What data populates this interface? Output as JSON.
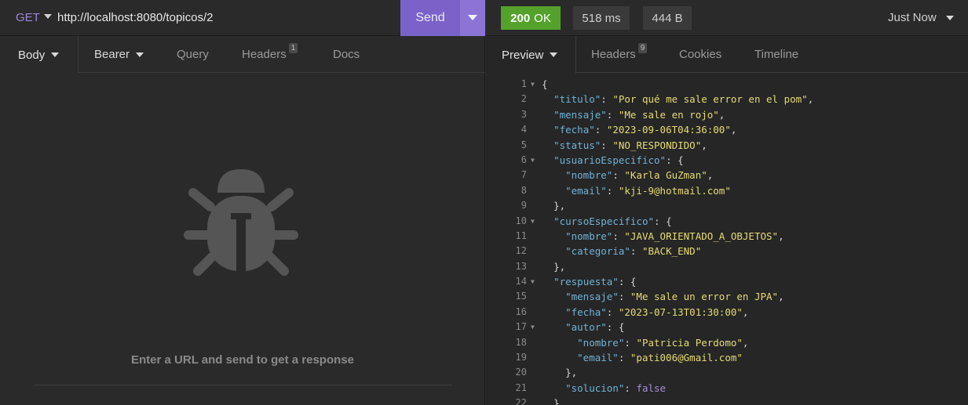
{
  "request": {
    "method": "GET",
    "url": "http://localhost:8080/topicos/2",
    "send_label": "Send",
    "tabs": {
      "body": "Body",
      "auth": "Bearer",
      "query": "Query",
      "headers": "Headers",
      "headers_count": "1",
      "docs": "Docs"
    },
    "empty_message": "Enter a URL and send to get a response",
    "empty_icon": "bug-icon"
  },
  "response": {
    "status_code": "200",
    "status_text": "OK",
    "time": "518 ms",
    "size": "444 B",
    "when": "Just Now",
    "colors": {
      "status_ok": "#54a22b",
      "accent": "#7b62c9"
    },
    "tabs": {
      "preview": "Preview",
      "headers": "Headers",
      "headers_count": "9",
      "cookies": "Cookies",
      "timeline": "Timeline"
    },
    "lines": [
      {
        "n": "1",
        "fold": true,
        "indent": "",
        "key": "",
        "value": "",
        "type": "",
        "open": "{",
        "tail": ""
      },
      {
        "n": "2",
        "fold": false,
        "indent": "  ",
        "key": "titulo",
        "value": "\"Por qué me sale error en el pom\"",
        "type": "s",
        "open": "",
        "tail": ","
      },
      {
        "n": "3",
        "fold": false,
        "indent": "  ",
        "key": "mensaje",
        "value": "\"Me sale en rojo\"",
        "type": "s",
        "open": "",
        "tail": ","
      },
      {
        "n": "4",
        "fold": false,
        "indent": "  ",
        "key": "fecha",
        "value": "\"2023-09-06T04:36:00\"",
        "type": "s",
        "open": "",
        "tail": ","
      },
      {
        "n": "5",
        "fold": false,
        "indent": "  ",
        "key": "status",
        "value": "\"NO_RESPONDIDO\"",
        "type": "s",
        "open": "",
        "tail": ","
      },
      {
        "n": "6",
        "fold": true,
        "indent": "  ",
        "key": "usuarioEspecifico",
        "value": "",
        "type": "",
        "open": "{",
        "tail": ""
      },
      {
        "n": "7",
        "fold": false,
        "indent": "    ",
        "key": "nombre",
        "value": "\"Karla GuZman\"",
        "type": "s",
        "open": "",
        "tail": ","
      },
      {
        "n": "8",
        "fold": false,
        "indent": "    ",
        "key": "email",
        "value": "\"kji-9@hotmail.com\"",
        "type": "s",
        "open": "",
        "tail": ""
      },
      {
        "n": "9",
        "fold": false,
        "indent": "  ",
        "key": "",
        "value": "",
        "type": "",
        "open": "},",
        "tail": ""
      },
      {
        "n": "10",
        "fold": true,
        "indent": "  ",
        "key": "cursoEspecifico",
        "value": "",
        "type": "",
        "open": "{",
        "tail": ""
      },
      {
        "n": "11",
        "fold": false,
        "indent": "    ",
        "key": "nombre",
        "value": "\"JAVA_ORIENTADO_A_OBJETOS\"",
        "type": "s",
        "open": "",
        "tail": ","
      },
      {
        "n": "12",
        "fold": false,
        "indent": "    ",
        "key": "categoria",
        "value": "\"BACK_END\"",
        "type": "s",
        "open": "",
        "tail": ""
      },
      {
        "n": "13",
        "fold": false,
        "indent": "  ",
        "key": "",
        "value": "",
        "type": "",
        "open": "},",
        "tail": ""
      },
      {
        "n": "14",
        "fold": true,
        "indent": "  ",
        "key": "respuesta",
        "value": "",
        "type": "",
        "open": "{",
        "tail": ""
      },
      {
        "n": "15",
        "fold": false,
        "indent": "    ",
        "key": "mensaje",
        "value": "\"Me sale un error en JPA\"",
        "type": "s",
        "open": "",
        "tail": ","
      },
      {
        "n": "16",
        "fold": false,
        "indent": "    ",
        "key": "fecha",
        "value": "\"2023-07-13T01:30:00\"",
        "type": "s",
        "open": "",
        "tail": ","
      },
      {
        "n": "17",
        "fold": true,
        "indent": "    ",
        "key": "autor",
        "value": "",
        "type": "",
        "open": "{",
        "tail": ""
      },
      {
        "n": "18",
        "fold": false,
        "indent": "      ",
        "key": "nombre",
        "value": "\"Patricia Perdomo\"",
        "type": "s",
        "open": "",
        "tail": ","
      },
      {
        "n": "19",
        "fold": false,
        "indent": "      ",
        "key": "email",
        "value": "\"pati006@Gmail.com\"",
        "type": "s",
        "open": "",
        "tail": ""
      },
      {
        "n": "20",
        "fold": false,
        "indent": "    ",
        "key": "",
        "value": "",
        "type": "",
        "open": "},",
        "tail": ""
      },
      {
        "n": "21",
        "fold": false,
        "indent": "    ",
        "key": "solucion",
        "value": "false",
        "type": "b",
        "open": "",
        "tail": ""
      },
      {
        "n": "22",
        "fold": false,
        "indent": "  ",
        "key": "",
        "value": "",
        "type": "",
        "open": "}",
        "tail": ""
      }
    ]
  }
}
